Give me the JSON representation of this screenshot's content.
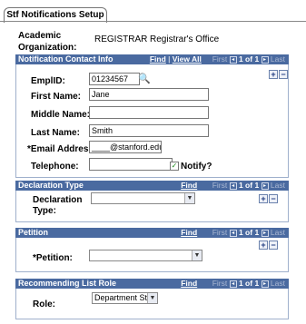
{
  "tab": {
    "label": "Stf Notifications Setup"
  },
  "org": {
    "label": "Academic Organization:",
    "code": "REGISTRAR",
    "name": "Registrar's Office"
  },
  "notification": {
    "title": "Notification Contact Info",
    "find": "Find",
    "view_all": "View All",
    "first": "First",
    "count": "1 of 1",
    "last": "Last",
    "emplid_label": "EmplID:",
    "emplid_value": "01234567",
    "first_name_label": "First Name:",
    "first_name_value": "Jane",
    "middle_name_label": "Middle Name:",
    "middle_name_value": "",
    "last_name_label": "Last Name:",
    "last_name_value": "Smith",
    "email_label": "*Email Address:",
    "email_value": "____@stanford.edu",
    "telephone_label": "Telephone:",
    "telephone_value": "",
    "notify_label": "Notify?",
    "notify_checked": true
  },
  "declaration": {
    "title": "Declaration Type",
    "find": "Find",
    "first": "First",
    "count": "1 of 1",
    "last": "Last",
    "label_line1": "Declaration",
    "label_line2": "Type:",
    "value": ""
  },
  "petition": {
    "title": "Petition",
    "find": "Find",
    "first": "First",
    "count": "1 of 1",
    "last": "Last",
    "label": "*Petition:",
    "value": ""
  },
  "recommending": {
    "title": "Recommending List Role",
    "find": "Find",
    "first": "First",
    "count": "1 of 1",
    "last": "Last",
    "label": "Role:",
    "value": "Department St"
  }
}
